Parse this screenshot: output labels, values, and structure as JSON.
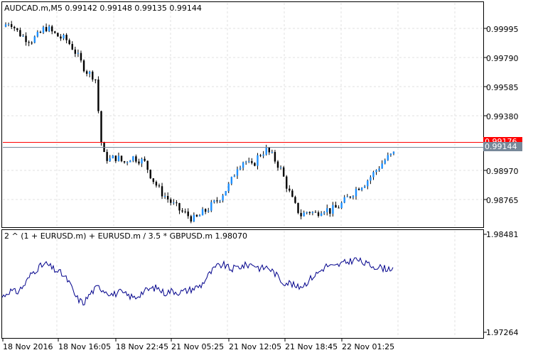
{
  "main_chart": {
    "header": "AUDCAD.m,M5  0.99142 0.99148 0.99135 0.99144",
    "y_ticks": [
      "0.99995",
      "0.99790",
      "0.99585",
      "0.99380",
      "0.98970",
      "0.98765"
    ],
    "price_tags": [
      {
        "label": "0.99176",
        "color": "#ff0000"
      },
      {
        "label": "0.99144",
        "color": "#778899"
      }
    ]
  },
  "indicator": {
    "header": "2 ^ (1 + EURUSD.m) + EURUSD.m / 3.5 * GBPUSD.m 1.98070",
    "y_ticks": [
      "1.98481",
      "1.97264"
    ]
  },
  "time_axis": [
    "18 Nov 2016",
    "18 Nov 16:05",
    "18 Nov 22:45",
    "21 Nov 05:25",
    "21 Nov 12:05",
    "21 Nov 18:45",
    "22 Nov 01:25"
  ],
  "colors": {
    "up": "#1e90ff",
    "down": "#000000",
    "indicator": "#00008b",
    "grid": "#e0e0e0",
    "ask_line": "#ff0000",
    "bid_line": "#778899"
  },
  "chart_data": [
    {
      "type": "candlestick",
      "title": "AUDCAD.m,M5",
      "x": [
        "18 Nov 2016",
        "18 Nov 16:05",
        "18 Nov 22:45",
        "21 Nov 05:25",
        "21 Nov 12:05",
        "21 Nov 18:45",
        "22 Nov 01:25"
      ],
      "close_path": [
        0.9999,
        1.0003,
        0.9996,
        0.9992,
        0.999,
        0.9993,
        0.9999,
        0.9995,
        0.9992,
        0.999,
        0.9984,
        0.9975,
        0.9968,
        0.9966,
        0.9914,
        0.991,
        0.9912,
        0.9908,
        0.9912,
        0.9911,
        0.9908,
        0.9898,
        0.989,
        0.9885,
        0.988,
        0.9876,
        0.9873,
        0.987,
        0.9874,
        0.9878,
        0.9882,
        0.9888,
        0.9894,
        0.9906,
        0.991,
        0.9905,
        0.9913,
        0.9917,
        0.9912,
        0.9905,
        0.9892,
        0.988,
        0.9873,
        0.9876,
        0.9874,
        0.9878,
        0.9876,
        0.9878,
        0.9882,
        0.9887,
        0.9892,
        0.9895,
        0.99,
        0.9906,
        0.9911,
        0.9914
      ],
      "ylim": [
        0.9866,
        1.0015
      ]
    },
    {
      "type": "line",
      "title": "2 ^ (1 + EURUSD.m) + EURUSD.m / 3.5 * GBPUSD.m",
      "values": [
        1.977,
        1.9778,
        1.9776,
        1.9785,
        1.98,
        1.9808,
        1.9812,
        1.9805,
        1.98,
        1.979,
        1.977,
        1.9762,
        1.9775,
        1.9783,
        1.9778,
        1.9773,
        1.9776,
        1.9772,
        1.9769,
        1.9776,
        1.978,
        1.9782,
        1.9775,
        1.9778,
        1.9776,
        1.9778,
        1.9781,
        1.9785,
        1.9798,
        1.9808,
        1.9811,
        1.9805,
        1.9808,
        1.981,
        1.9812,
        1.9806,
        1.9808,
        1.98,
        1.9789,
        1.9788,
        1.9782,
        1.9786,
        1.9795,
        1.9802,
        1.981,
        1.9808,
        1.9812,
        1.9815,
        1.9818,
        1.9813,
        1.981,
        1.9808,
        1.9806,
        1.9807
      ],
      "ylim": [
        1.972,
        1.9853
      ]
    }
  ]
}
